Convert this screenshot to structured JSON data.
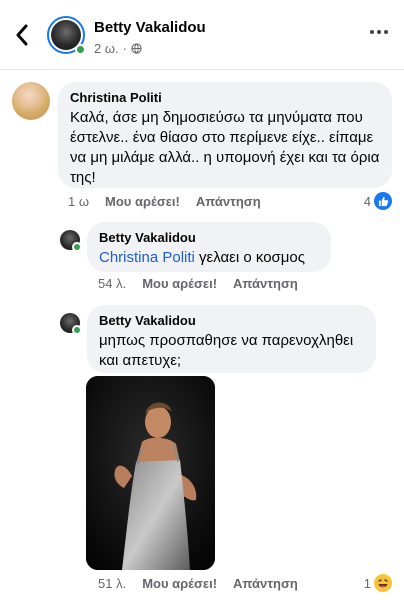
{
  "header": {
    "name": "Betty Vakalidou",
    "time": "2 ω.",
    "privacy_icon": "globe-icon"
  },
  "comments": [
    {
      "author": "Christina Politi",
      "text": "Καλά, άσε μη δημοσιεύσω τα μηνύματα που έστελνε.. ένα θίασο στο περίμενε είχε.. είπαμε να μη μιλάμε αλλά.. η υπομονή έχει και τα όρια της!",
      "time": "1 ω",
      "like_label": "Μου αρέσει!",
      "reply_label": "Απάντηση",
      "reaction_count": "4",
      "reaction_icon": "like-icon"
    },
    {
      "author": "Betty Vakalidou",
      "mention": "Christina Politi",
      "text": " γελαει ο κοσμος",
      "time": "54 λ.",
      "like_label": "Μου αρέσει!",
      "reply_label": "Απάντηση"
    },
    {
      "author": "Betty Vakalidou",
      "text": "μηπως προσπαθησε να παρενοχληθει και απετυχε;",
      "time": "51 λ.",
      "like_label": "Μου αρέσει!",
      "reply_label": "Απάντηση",
      "reaction_count": "1",
      "reaction_icon": "haha-icon"
    }
  ],
  "colors": {
    "accent": "#1877f2",
    "bubble": "#f0f2f5",
    "online": "#31a24c",
    "muted": "#65676b"
  }
}
